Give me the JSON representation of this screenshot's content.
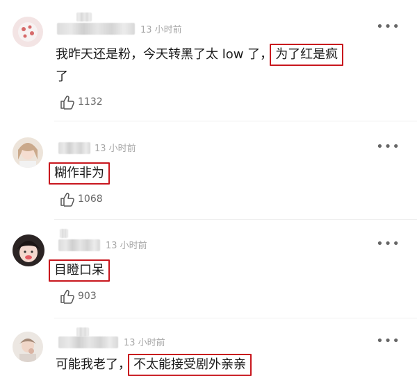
{
  "comments": [
    {
      "time": "13 小时前",
      "more": "•••",
      "text_line1_plain": "我昨天还是粉，今天转黑了太 low 了，",
      "text_line1_highlight": "为了红是疯",
      "text_line2": "了",
      "likes": "1132"
    },
    {
      "time": "13 小时前",
      "more": "•••",
      "text_highlight": "糊作非为",
      "likes": "1068"
    },
    {
      "time": "13 小时前",
      "more": "•••",
      "text_highlight": "目瞪口呆",
      "likes": "903"
    },
    {
      "time": "13 小时前",
      "more": "•••",
      "text_plain": "可能我老了，",
      "text_highlight": "不太能接受剧外亲亲"
    }
  ],
  "colors": {
    "highlight_border": "#c8161d",
    "time_text": "#a8a8a8",
    "body_text": "#1a1a1a"
  },
  "icons": {
    "like": "thumbs-up-icon",
    "more": "more-dots-icon"
  }
}
